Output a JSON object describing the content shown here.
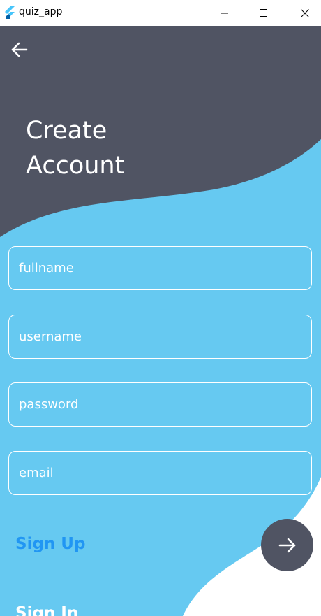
{
  "window": {
    "title": "quiz_app",
    "icon": "flutter-icon",
    "controls": [
      "minimize-icon",
      "maximize-icon",
      "close-icon"
    ]
  },
  "header": {
    "back_icon": "arrow-left-icon",
    "title_line1": "Create",
    "title_line2": "Account"
  },
  "form": {
    "fullname_placeholder": "fullname",
    "username_placeholder": "username",
    "password_placeholder": "password",
    "email_placeholder": "email"
  },
  "actions": {
    "signup_label": "Sign Up",
    "submit_icon": "arrow-right-icon",
    "signin_label": "Sign In"
  },
  "colors": {
    "dark_header": "#505463",
    "sky_blue": "#66c9f1",
    "accent_blue": "#2196f3",
    "white": "#ffffff"
  }
}
